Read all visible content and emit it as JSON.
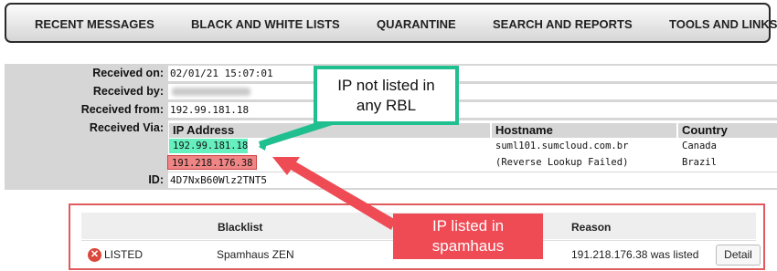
{
  "nav": {
    "items": [
      "RECENT MESSAGES",
      "BLACK AND WHITE LISTS",
      "QUARANTINE",
      "SEARCH AND REPORTS",
      "TOOLS AND LINKS"
    ]
  },
  "message": {
    "received_on_label": "Received on:",
    "received_on": "02/01/21 15:07:01",
    "received_by_label": "Received by:",
    "received_from_label": "Received from:",
    "received_from": "192.99.181.18",
    "received_via_label": "Received Via:",
    "via_headers": {
      "ip": "IP Address",
      "hostname": "Hostname",
      "country": "Country"
    },
    "via_rows": [
      {
        "ip": "192.99.181.18",
        "hostname": "suml101.sumcloud.com.br",
        "country": "Canada",
        "status_color": "#66f0c0"
      },
      {
        "ip": "191.218.176.38",
        "hostname": "(Reverse Lookup Failed)",
        "country": "Brazil",
        "status_color": "#f08585"
      }
    ],
    "id_label": "ID:",
    "id": "4D7NxB60Wlz2TNT5"
  },
  "blacklist": {
    "headers": {
      "blacklist": "Blacklist",
      "reason": "Reason"
    },
    "row": {
      "status": "LISTED",
      "name": "Spamhaus ZEN",
      "reason": "191.218.176.38 was listed",
      "detail_label": "Detail"
    }
  },
  "callouts": {
    "not_listed": "IP not listed in any RBL",
    "listed": "IP listed in spamhaus"
  },
  "colors": {
    "green_callout": "#1fbf8f",
    "red_callout": "#ef4b55",
    "listed_icon": "#d9483b"
  }
}
